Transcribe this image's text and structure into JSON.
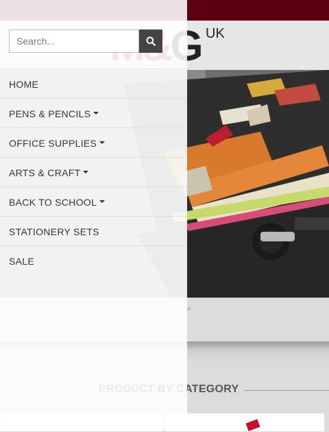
{
  "brand": {
    "logo_text": "M&G",
    "logo_suffix": "UK"
  },
  "search": {
    "placeholder": "Search..."
  },
  "menu": {
    "items": [
      {
        "label": "HOME",
        "has_dropdown": false
      },
      {
        "label": "PENS & PENCILS",
        "has_dropdown": true
      },
      {
        "label": "OFFICE SUPPLIES",
        "has_dropdown": true
      },
      {
        "label": "ARTS & CRAFT",
        "has_dropdown": true
      },
      {
        "label": "BACK TO SCHOOL",
        "has_dropdown": true
      },
      {
        "label": "STATIONERY SETS",
        "has_dropdown": false
      },
      {
        "label": "SALE",
        "has_dropdown": false
      }
    ]
  },
  "section": {
    "title": "PRODUCT BY CATEGORY"
  },
  "icons": {
    "search_button": "search-icon",
    "dropdown": "caret-down-icon"
  },
  "colors": {
    "topbar": "#5c0010",
    "brand_red": "#d41f2a",
    "search_button": "#444444"
  }
}
